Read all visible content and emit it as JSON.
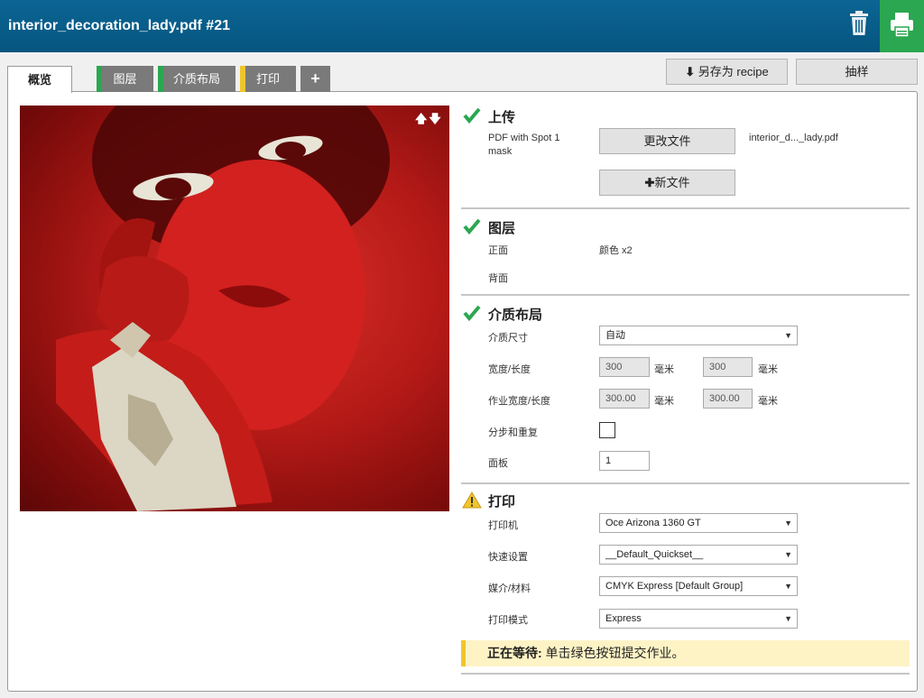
{
  "header": {
    "title": "interior_decoration_lady.pdf #21"
  },
  "tabs": [
    {
      "label": "概览"
    },
    {
      "label": "图层",
      "color": "#2aa750"
    },
    {
      "label": "介质布局",
      "color": "#2aa750"
    },
    {
      "label": "打印",
      "color": "#f0c52c"
    },
    {
      "label": "+"
    }
  ],
  "toolbar": {
    "save_recipe": "另存为 recipe",
    "sample": "抽样"
  },
  "upload": {
    "title": "上传",
    "file_type_line1": "PDF with Spot 1",
    "file_type_line2": "mask",
    "change_file": "更改文件",
    "file_name": "interior_d..._lady.pdf",
    "new_file": "新文件"
  },
  "layers": {
    "title": "图层",
    "front_label": "正面",
    "front_value": "颜色 x2",
    "back_label": "背面"
  },
  "media": {
    "title": "介质布局",
    "size_label": "介质尺寸",
    "size_value": "自动",
    "wl_label": "宽度/长度",
    "width": "300",
    "length": "300",
    "unit": "毫米",
    "job_wl_label": "作业宽度/长度",
    "job_width": "300.00",
    "job_length": "300.00",
    "step_label": "分步和重复",
    "panel_label": "面板",
    "panel_value": "1"
  },
  "print": {
    "title": "打印",
    "printer_label": "打印机",
    "printer_value": "Oce Arizona 1360 GT",
    "quickset_label": "快速设置",
    "quickset_value": "__Default_Quickset__",
    "media_label": "媒介/材料",
    "media_value": "CMYK Express [Default Group]",
    "mode_label": "打印模式",
    "mode_value": "Express"
  },
  "status": {
    "bold": "正在等待:",
    "text": " 单击绿色按钮提交作业。"
  },
  "colors": {
    "accent_green": "#2aa750",
    "warning_yellow": "#f0c52c",
    "header_blue": "#06557f"
  }
}
